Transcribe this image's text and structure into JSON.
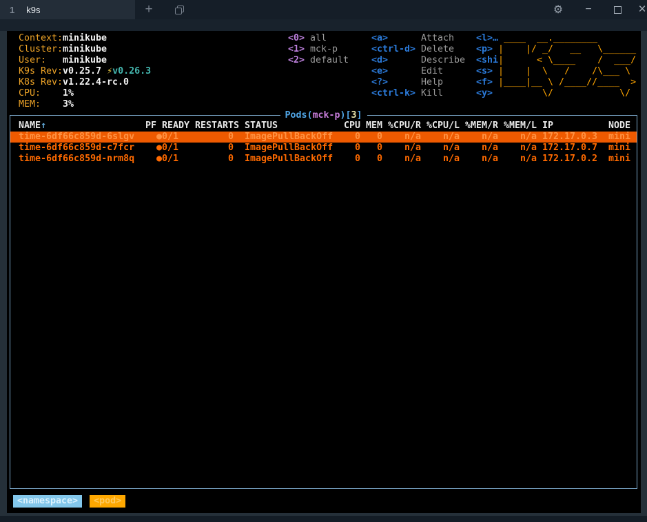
{
  "colors": {
    "accent_orange": "#ffa500",
    "row_orange": "#ff6a00",
    "selected_row_bg": "#ee5a00",
    "key_blue": "#2b7bdb",
    "key_purple": "#bd80dd",
    "label_orange": "#eda327",
    "upgrade_teal": "#45b8b0",
    "panel_border_blue": "#7fadd0",
    "crumb_namespace_bg": "#83c7eb",
    "crumb_pod_bg": "#ffa800"
  },
  "titlebar": {
    "tab_index": "1",
    "tab_title": "k9s",
    "plus_icon": "+",
    "gear_icon": "⚙",
    "minimize_icon": "−",
    "close_icon": "×"
  },
  "header": {
    "info": {
      "context_label": "Context:",
      "context": "minikube",
      "cluster_label": "Cluster:",
      "cluster": "minikube",
      "user_label": "User:",
      "user": "minikube",
      "k9s_rev_label": "K9s Rev:",
      "k9s_rev": "v0.25.7",
      "upgrade_icon": "⚡",
      "k9s_rev_new": "v0.26.3",
      "k8s_rev_label": "K8s Rev:",
      "k8s_rev": "v1.22.4-rc.0",
      "cpu_label": "CPU:",
      "cpu": "1%",
      "mem_label": "MEM:",
      "mem": "3%"
    },
    "ns_keys": [
      {
        "key": "<0>",
        "name": "all"
      },
      {
        "key": "<1>",
        "name": "mck-p"
      },
      {
        "key": "<2>",
        "name": "default"
      }
    ],
    "action_keys": [
      {
        "key": "<a>",
        "name": "Attach"
      },
      {
        "key": "<ctrl-d>",
        "name": "Delete"
      },
      {
        "key": "<d>",
        "name": "Describe"
      },
      {
        "key": "<e>",
        "name": "Edit"
      },
      {
        "key": "<?>",
        "name": "Help"
      },
      {
        "key": "<ctrl-k>",
        "name": "Kill"
      }
    ],
    "extra_keys": [
      "<l>…",
      "<p>",
      "<shi",
      "<s>",
      "<f>",
      "<y>"
    ],
    "logo_text": " ____  __.________\n|    |/ _/   __   \\______\n|      < \\____    /  ___/\n|    |  \\   /    /\\___ \\ \n|____|__ \\ /____//____  >\n        \\/            \\/ "
  },
  "panel": {
    "title_prefix": "Pods(",
    "title_namespace": "mck-p",
    "title_mid": ")[",
    "title_count": "3",
    "title_suffix": "]",
    "columns": {
      "name": "NAME",
      "sort_arrow": "↑",
      "pf": "PF",
      "ready": "READY",
      "restarts": "RESTARTS",
      "status": "STATUS",
      "cpu": "CPU",
      "mem": "MEM",
      "cpu_r": "%CPU/R",
      "cpu_l": "%CPU/L",
      "mem_r": "%MEM/R",
      "mem_l": "%MEM/L",
      "ip": "IP",
      "node": "NODE"
    },
    "rows": [
      {
        "name": "time-6df66c859d-6slgv",
        "pf": "●",
        "ready": "0/1",
        "restarts": "0",
        "status": "ImagePullBackOff",
        "cpu": "0",
        "mem": "0",
        "cpu_r": "n/a",
        "cpu_l": "n/a",
        "mem_r": "n/a",
        "mem_l": "n/a",
        "ip": "172.17.0.3",
        "node": "mini",
        "selected": true
      },
      {
        "name": "time-6df66c859d-c7fcr",
        "pf": "●",
        "ready": "0/1",
        "restarts": "0",
        "status": "ImagePullBackOff",
        "cpu": "0",
        "mem": "0",
        "cpu_r": "n/a",
        "cpu_l": "n/a",
        "mem_r": "n/a",
        "mem_l": "n/a",
        "ip": "172.17.0.7",
        "node": "mini",
        "selected": false
      },
      {
        "name": "time-6df66c859d-nrm8q",
        "pf": "●",
        "ready": "0/1",
        "restarts": "0",
        "status": "ImagePullBackOff",
        "cpu": "0",
        "mem": "0",
        "cpu_r": "n/a",
        "cpu_l": "n/a",
        "mem_r": "n/a",
        "mem_l": "n/a",
        "ip": "172.17.0.2",
        "node": "mini",
        "selected": false
      }
    ]
  },
  "crumbs": [
    {
      "label": "<namespace>"
    },
    {
      "label": "<pod>"
    }
  ]
}
